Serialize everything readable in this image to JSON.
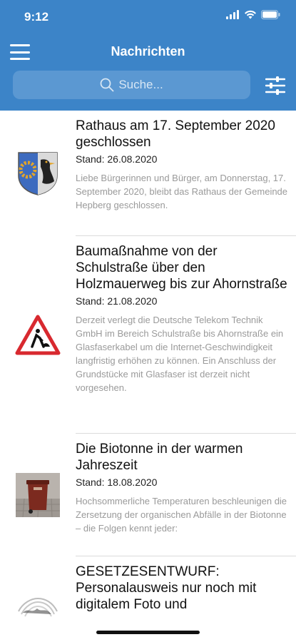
{
  "status_bar": {
    "time": "9:12"
  },
  "nav": {
    "title": "Nachrichten"
  },
  "search": {
    "placeholder": "Suche..."
  },
  "news": [
    {
      "title": "Rathaus am 17. September 2020 geschlossen",
      "date": "Stand: 26.08.2020",
      "excerpt": "Liebe Bürgerinnen und Bürger,  am Donnerstag, 17. September 2020, bleibt das Rathaus der Gemeinde Hepberg geschlossen.",
      "thumbnail": "coat-of-arms-icon"
    },
    {
      "title": "Baumaßnahme von der Schulstraße über den Holzmauerweg bis zur Ahornstraße",
      "date": "Stand: 21.08.2020",
      "excerpt": "Derzeit verlegt die Deutsche Telekom Technik GmbH im Bereich Schulstraße bis Ahornstraße ein Glasfaserkabel um die Internet-Geschwindigkeit langfristig erhöhen zu können. Ein Anschluss der Grundstücke mit Glasfaser ist derzeit nicht vorgesehen.",
      "thumbnail": "roadwork-sign-icon"
    },
    {
      "title": "Die Biotonne in der warmen Jahreszeit",
      "date": "Stand: 18.08.2020",
      "excerpt": "Hochsommerliche Temperaturen beschleunigen die Zersetzung der organischen Abfälle in der Biotonne – die Folgen kennt jeder:",
      "thumbnail": "bin-photo"
    },
    {
      "title": "GESETZESENTWURF: Personalausweis nur noch mit digitalem Foto und",
      "date": "",
      "excerpt": "",
      "thumbnail": "fingerprint-photo"
    }
  ],
  "colors": {
    "header": "#3c84c8",
    "search_bg": "#5b98d2",
    "excerpt": "#9a9a9a"
  }
}
